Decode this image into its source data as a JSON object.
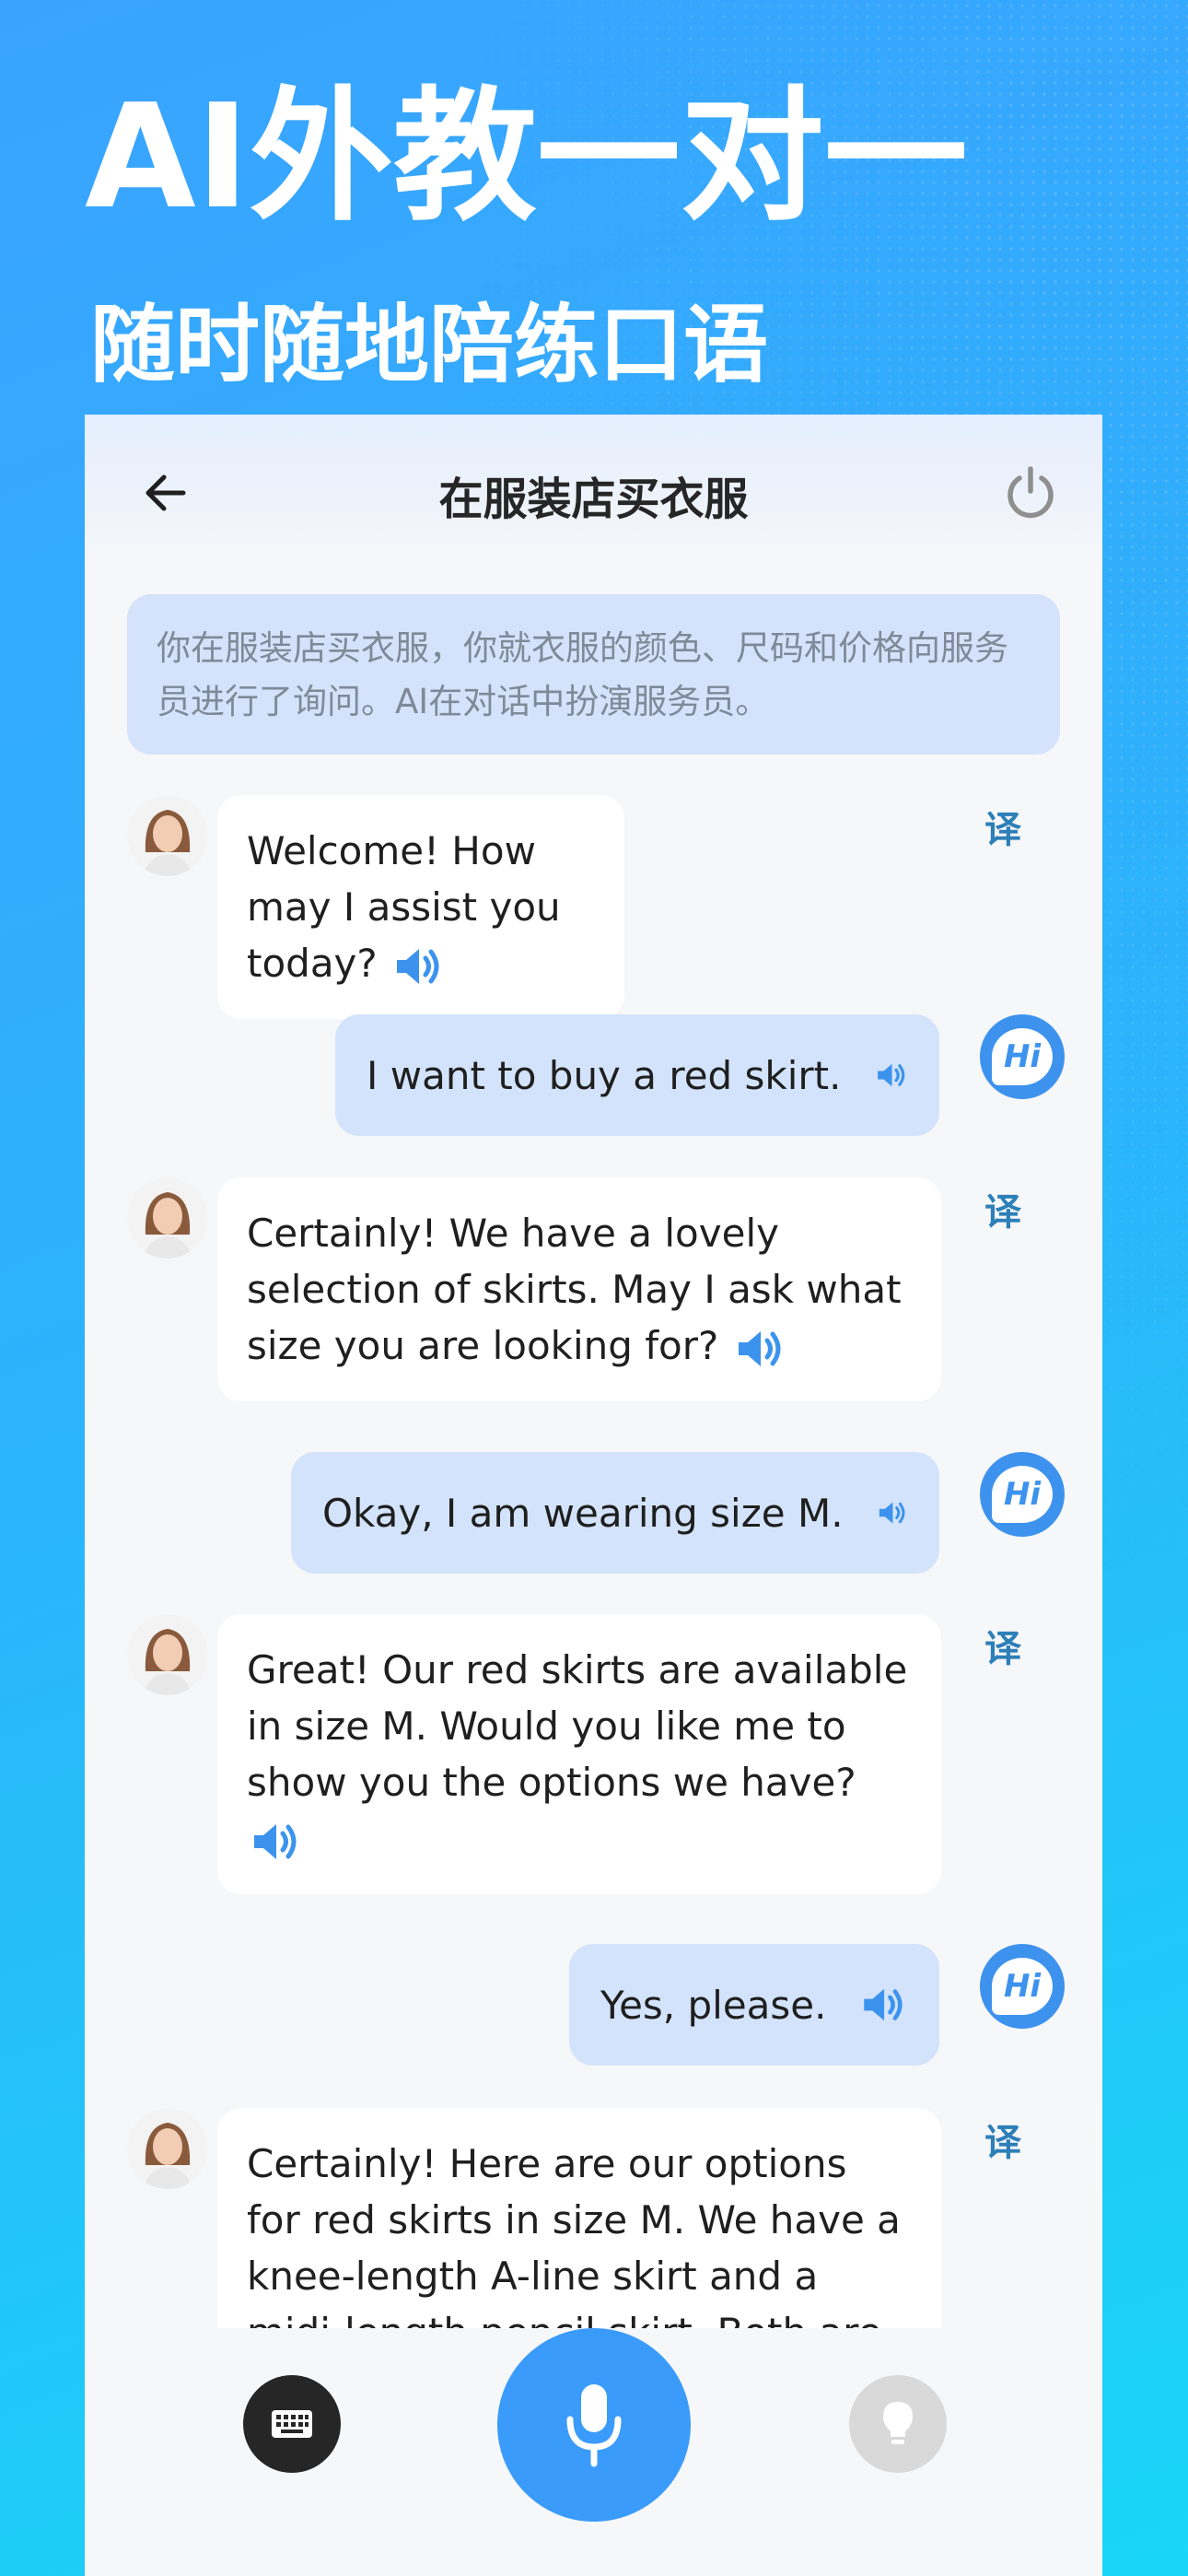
{
  "promo": {
    "headline": "AI外教一对一",
    "subheadline": "随时随地陪练口语"
  },
  "header": {
    "title": "在服装店买衣服",
    "back_icon": "arrow-left-icon",
    "power_icon": "power-icon"
  },
  "scenario": {
    "text": "你在服装店买衣服，你就衣服的颜色、尺码和价格向服务员进行了询问。AI在对话中扮演服务员。"
  },
  "messages": [
    {
      "role": "ai",
      "text": "Welcome! How may I assist you today?",
      "translate_label": "译"
    },
    {
      "role": "user",
      "text": "I want to buy a red skirt.",
      "avatar_label": "Hi"
    },
    {
      "role": "ai",
      "text": "Certainly! We have a lovely selection of skirts. May I ask what size you are looking for?",
      "translate_label": "译"
    },
    {
      "role": "user",
      "text": "Okay, I am wearing size M.",
      "avatar_label": "Hi"
    },
    {
      "role": "ai",
      "text": "Great! Our red skirts are available in size M. Would you like me to show you the options we have?",
      "translate_label": "译"
    },
    {
      "role": "user",
      "text": "Yes, please.",
      "avatar_label": "Hi"
    },
    {
      "role": "ai",
      "text": "Certainly! Here are our options for red skirts in size M. We have a knee-length A-line skirt and a midi-length pencil skirt. Both are",
      "translate_label": "译"
    }
  ],
  "controls": {
    "keyboard_icon": "keyboard-icon",
    "mic_icon": "microphone-icon",
    "hint_icon": "lightbulb-icon"
  },
  "colors": {
    "background_start": "#3aa3ff",
    "background_end": "#19d6f7",
    "accent": "#3b9bfb",
    "user_bubble": "#d3e3fb",
    "translate_text": "#2d7fb8"
  }
}
